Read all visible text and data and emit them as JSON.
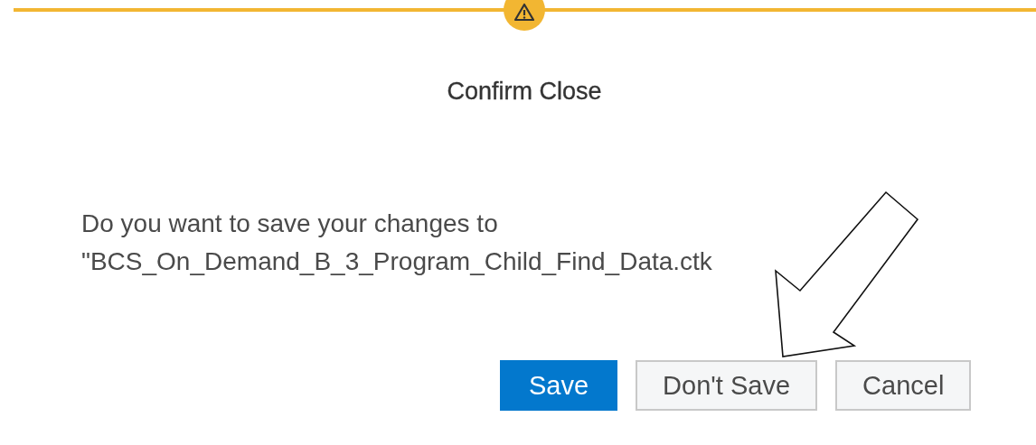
{
  "dialog": {
    "title": "Confirm Close",
    "kind": "warning",
    "message_lines": [
      "Do you want to save your changes to",
      "\"BCS_On_Demand_B_3_Program_Child_Find_Data.ctk"
    ],
    "buttons": [
      {
        "label": "Save",
        "kind": "primary"
      },
      {
        "label": "Don't Save",
        "kind": "secondary"
      },
      {
        "label": "Cancel",
        "kind": "secondary"
      }
    ]
  },
  "annotation": {
    "kind": "arrow"
  }
}
